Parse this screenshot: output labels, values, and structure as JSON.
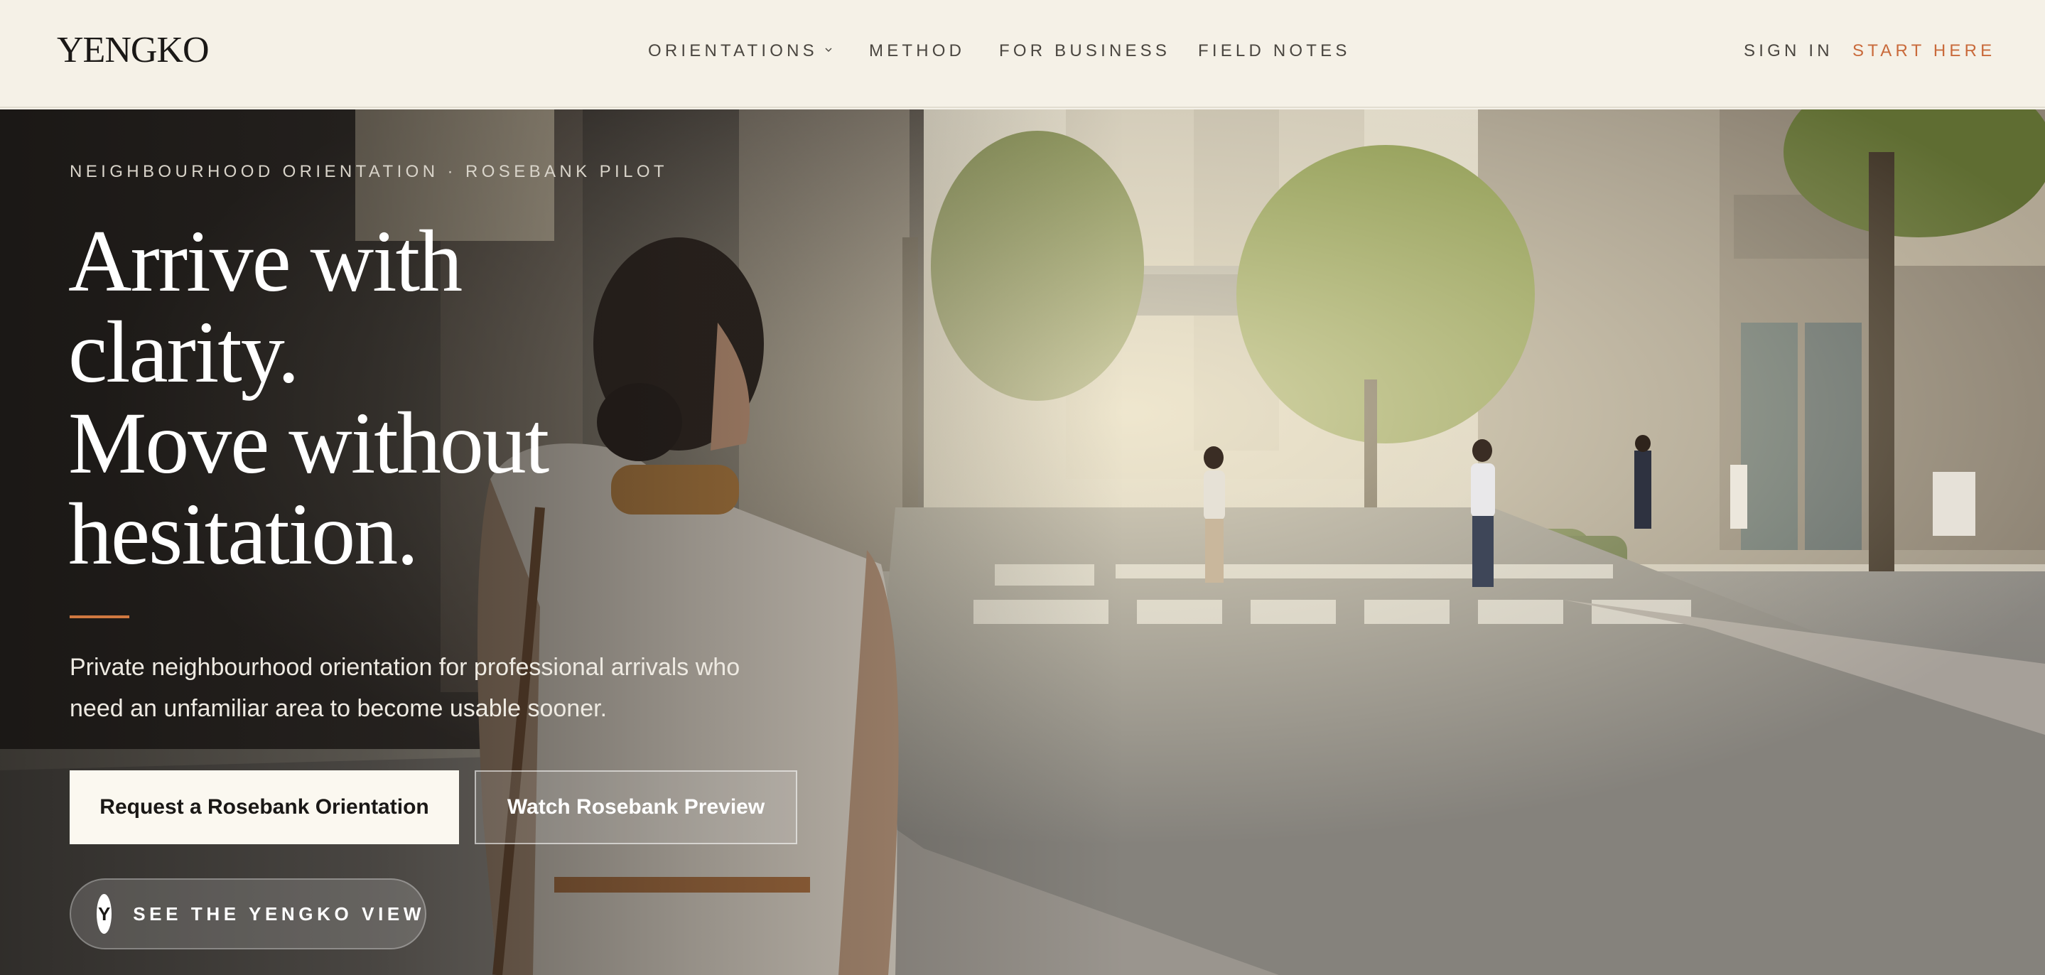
{
  "brand": {
    "logo": "YENGKO"
  },
  "nav": {
    "items": [
      {
        "label": "ORIENTATIONS",
        "has_dropdown": true
      },
      {
        "label": "METHOD"
      },
      {
        "label": "FOR BUSINESS"
      },
      {
        "label": "FIELD NOTES"
      }
    ],
    "sign_in": "SIGN IN",
    "start_here": "START HERE"
  },
  "hero": {
    "eyebrow": "NEIGHBOURHOOD ORIENTATION · ROSEBANK PILOT",
    "headline_lines": [
      "Arrive with",
      "clarity.",
      "Move without",
      "hesitation."
    ],
    "subtitle": "Private neighbourhood orientation for professional arrivals who need an unfamiliar area to become usable sooner.",
    "primary_cta": "Request a Rosebank Orientation",
    "secondary_cta": "Watch Rosebank Preview",
    "view_badge": "Y",
    "view_label": "SEE THE YENGKO VIEW"
  },
  "colors": {
    "accent": "#c96a3b",
    "header_bg": "#f5f1e7",
    "text_dark": "#1a1816"
  }
}
